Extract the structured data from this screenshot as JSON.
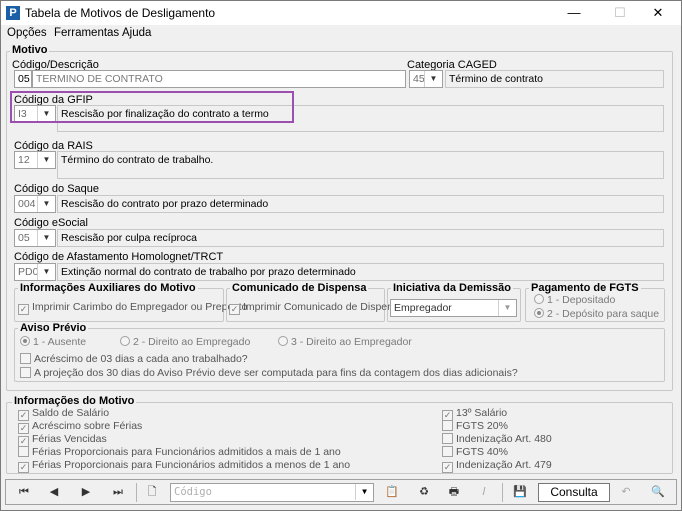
{
  "window": {
    "title": "Tabela de Motivos de Desligamento",
    "app_icon": "P"
  },
  "menu": {
    "opcoes": "Opções",
    "ferramentas": "Ferramentas",
    "ajuda": "Ajuda"
  },
  "motivo": {
    "title": "Motivo",
    "codigo_label": "Código/Descrição",
    "codigo_value": "05",
    "descricao_value": "TERMINO DE CONTRATO",
    "caged_label": "Categoria CAGED",
    "caged_code": "45",
    "caged_desc": "Término de contrato",
    "gfip_label": "Código da GFIP",
    "gfip_code": "I3",
    "gfip_desc": "Rescisão por finalização do contrato a termo",
    "rais_label": "Código da RAIS",
    "rais_code": "12",
    "rais_desc": "Término do contrato de trabalho.",
    "saque_label": "Código do Saque",
    "saque_code": "004",
    "saque_desc": "Rescisão do contrato por prazo determinado",
    "esocial_label": "Código eSocial",
    "esocial_code": "05",
    "esocial_desc": "Rescisão por culpa recíproca",
    "afast_label": "Código de Afastamento Homolognet/TRCT",
    "afast_code": "PD0",
    "afast_desc": "Extinção normal do contrato de trabalho por prazo determinado"
  },
  "aux": {
    "title": "Informações Auxiliares do Motivo",
    "check": "Imprimir Carimbo do Empregador ou Preposto"
  },
  "dispensa": {
    "title": "Comunicado de Dispensa",
    "check": "Imprimir Comunicado de Dispensa"
  },
  "iniciativa": {
    "title": "Iniciativa da Demissão",
    "value": "Empregador"
  },
  "fgts": {
    "title": "Pagamento de FGTS",
    "opt1": "1 - Depositado",
    "opt2": "2 - Depósito para saque"
  },
  "aviso": {
    "title": "Aviso Prévio",
    "opt1": "1 - Ausente",
    "opt2": "2 - Direito ao Empregado",
    "opt3": "3 - Direito ao Empregador",
    "check1": "Acréscimo de 03 dias a cada ano trabalhado?",
    "check2": "A projeção dos 30 dias do Aviso Prévio deve ser computada para fins da contagem dos dias adicionais?"
  },
  "info": {
    "title": "Informações do Motivo",
    "left": [
      {
        "label": "Saldo de Salário",
        "checked": "✓"
      },
      {
        "label": "Acréscimo sobre Férias",
        "checked": "✓"
      },
      {
        "label": "Férias Vencidas",
        "checked": "✓"
      },
      {
        "label": "Férias Proporcionais para Funcionários admitidos a mais de 1 ano",
        "checked": ""
      },
      {
        "label": "Férias Proporcionais para Funcionários admitidos a menos de 1 ano",
        "checked": "✓"
      }
    ],
    "right": [
      {
        "label": "13º Salário",
        "checked": "✓"
      },
      {
        "label": "FGTS 20%",
        "checked": ""
      },
      {
        "label": "Indenização Art. 480",
        "checked": ""
      },
      {
        "label": "FGTS 40%",
        "checked": ""
      },
      {
        "label": "Indenização Art. 479",
        "checked": "✓"
      }
    ]
  },
  "toolbar": {
    "search_placeholder": "Código",
    "consulta": "Consulta"
  }
}
